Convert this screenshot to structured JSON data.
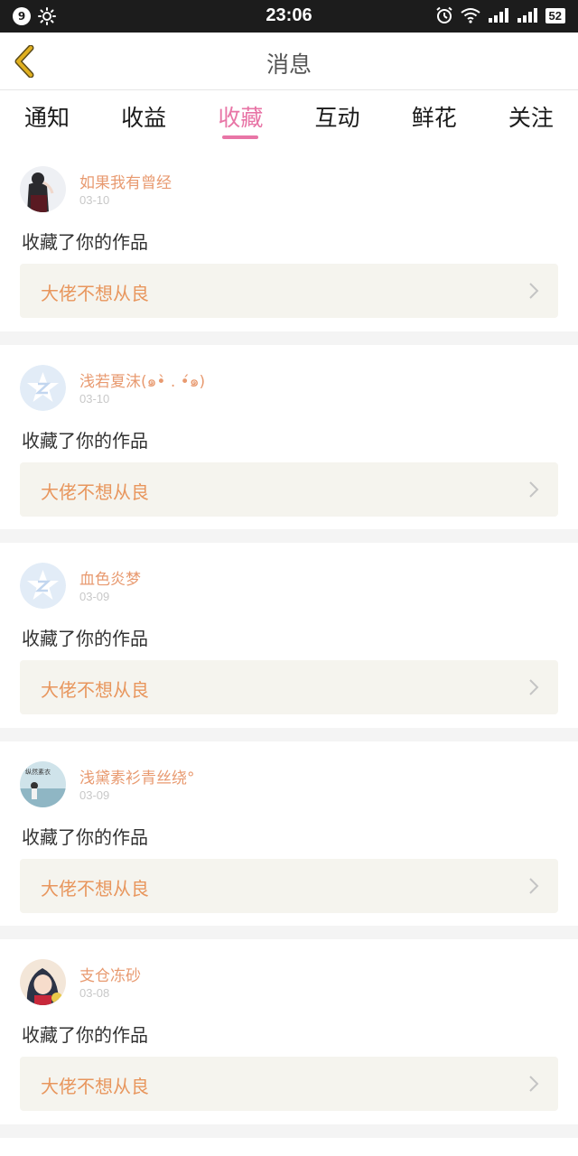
{
  "status_bar": {
    "notification_count": "9",
    "time": "23:06",
    "battery": "52"
  },
  "header": {
    "title": "消息"
  },
  "tabs": [
    {
      "label": "通知"
    },
    {
      "label": "收益"
    },
    {
      "label": "收藏"
    },
    {
      "label": "互动"
    },
    {
      "label": "鲜花"
    },
    {
      "label": "关注"
    }
  ],
  "active_tab": "收藏",
  "messages": [
    {
      "username": "如果我有曾经",
      "date": "03-10",
      "action": "收藏了你的作品",
      "work": "大佬不想从良",
      "avatar": "photo-avatar-girl"
    },
    {
      "username": "浅若夏沫(๑•̀ . •́๑)",
      "date": "03-10",
      "action": "收藏了你的作品",
      "work": "大佬不想从良",
      "avatar": "default-z-avatar"
    },
    {
      "username": "血色炎梦",
      "date": "03-09",
      "action": "收藏了你的作品",
      "work": "大佬不想从良",
      "avatar": "default-z-avatar"
    },
    {
      "username": "浅黛素衫青丝绕°",
      "date": "03-09",
      "action": "收藏了你的作品",
      "work": "大佬不想从良",
      "avatar": "photo-avatar-sky"
    },
    {
      "username": "支仓冻砂",
      "date": "03-08",
      "action": "收藏了你的作品",
      "work": "大佬不想从良",
      "avatar": "photo-avatar-anime"
    }
  ],
  "colors": {
    "accent_pink": "#e875a6",
    "username_orange": "#e89a70",
    "work_orange": "#e8965d",
    "work_box_bg": "#f5f4ee",
    "back_arrow": "#e0b020"
  }
}
